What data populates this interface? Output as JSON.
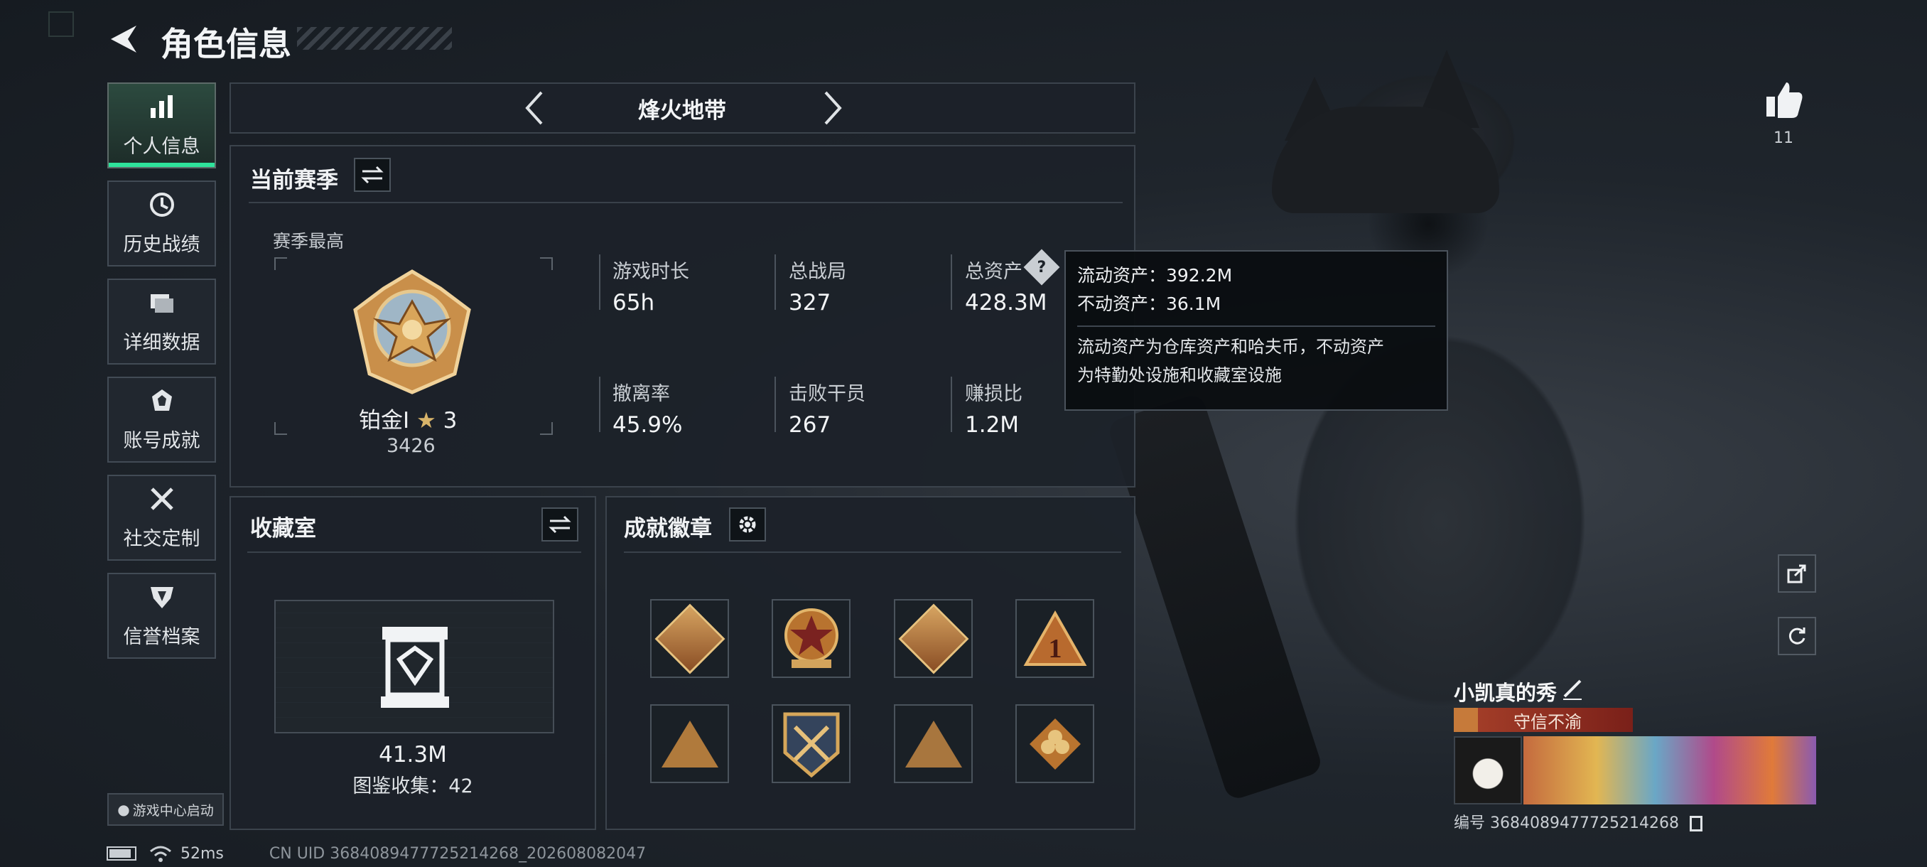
{
  "header": {
    "title": "角色信息"
  },
  "nav": {
    "items": [
      {
        "label": "个人信息",
        "icon": "bar-chart-icon",
        "active": true
      },
      {
        "label": "历史战绩",
        "icon": "history-icon",
        "active": false
      },
      {
        "label": "详细数据",
        "icon": "folder-icon",
        "active": false
      },
      {
        "label": "账号成就",
        "icon": "achievement-icon",
        "active": false
      },
      {
        "label": "社交定制",
        "icon": "tools-icon",
        "active": false
      },
      {
        "label": "信誉档案",
        "icon": "reputation-icon",
        "active": false
      }
    ],
    "game_center_label": "游戏中心启动"
  },
  "mode": {
    "title": "烽火地带"
  },
  "season": {
    "title": "当前赛季",
    "best_label": "赛季最高",
    "rank_name": "铂金Ⅰ",
    "rank_stars": "3",
    "rank_score": "3426",
    "stats": [
      {
        "label": "游戏时长",
        "value": "65h"
      },
      {
        "label": "总战局",
        "value": "327"
      },
      {
        "label": "总资产",
        "value": "428.3M"
      },
      {
        "label": "撤离率",
        "value": "45.9%"
      },
      {
        "label": "击败干员",
        "value": "267"
      },
      {
        "label": "赚损比",
        "value": "1.2M"
      }
    ]
  },
  "tooltip": {
    "liquid": "流动资产：392.2M",
    "fixed": "不动资产：36.1M",
    "desc_line1": "流动资产为仓库资产和哈夫币，不动资产",
    "desc_line2": "为特勤处设施和收藏室设施"
  },
  "collection": {
    "title": "收藏室",
    "value": "41.3M",
    "catalog": "图鉴收集：42"
  },
  "achievements": {
    "title": "成就徽章",
    "badges": [
      "dragon-badge",
      "star-shield-badge",
      "runner-badge",
      "number-one-badge",
      "mountain-badge",
      "crossed-swords-badge",
      "climber-badge",
      "flower-badge"
    ]
  },
  "profile": {
    "likes": "11",
    "player_name": "小凯真的秀",
    "title_text": "守信不渝",
    "id_text": "编号 3684089477725214268"
  },
  "status": {
    "ping": "52ms",
    "uid": "CN UID 3684089477725214268_20260808204​7"
  },
  "colors": {
    "accent": "#2ee39b",
    "panel": "#1c2229",
    "title_bar": "#8c2a22"
  }
}
